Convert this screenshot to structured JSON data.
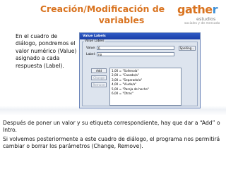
{
  "slide": {
    "title_line1": "Creación/Modificación de",
    "title_line2": "variables",
    "left_text": "En el cuadro de diálogo, pondremos el valor numérico (Value) asignado a cada respuesta (Label).",
    "bottom_text_1": "Después de poner un valor y su etiqueta correspondiente, hay que dar a “Add” o Intro.",
    "bottom_text_2": "Si volvemos posteriormente a este cuadro de diálogo, el programa nos permitirá cambiar o borrar los parámetros (Change, Remove)."
  },
  "logo": {
    "main_prefix": "gathe",
    "main_suffix": "r",
    "sub": "estudios",
    "tagline": "sociales y de mercado",
    "accent_color": "#d9731f"
  },
  "dialog": {
    "title": "Value Labels",
    "group_label": "Value Labels",
    "value_label": "Value:",
    "value_value": "6",
    "label_label": "Label:",
    "label_value": "no",
    "spelling_button": "Spelling...",
    "add_button": "Add",
    "change_button": "Change",
    "remove_button": "Remove",
    "list_items": [
      "1,00 = \"Sollenola\"",
      "2,00 = \"Casado/a\"",
      "3,00 = \"Separado/a\"",
      "4,00 = \"Viudo/a\"",
      "5,00 = \"Pareja de hecho\"",
      "6,00 = \"Otras\""
    ]
  }
}
